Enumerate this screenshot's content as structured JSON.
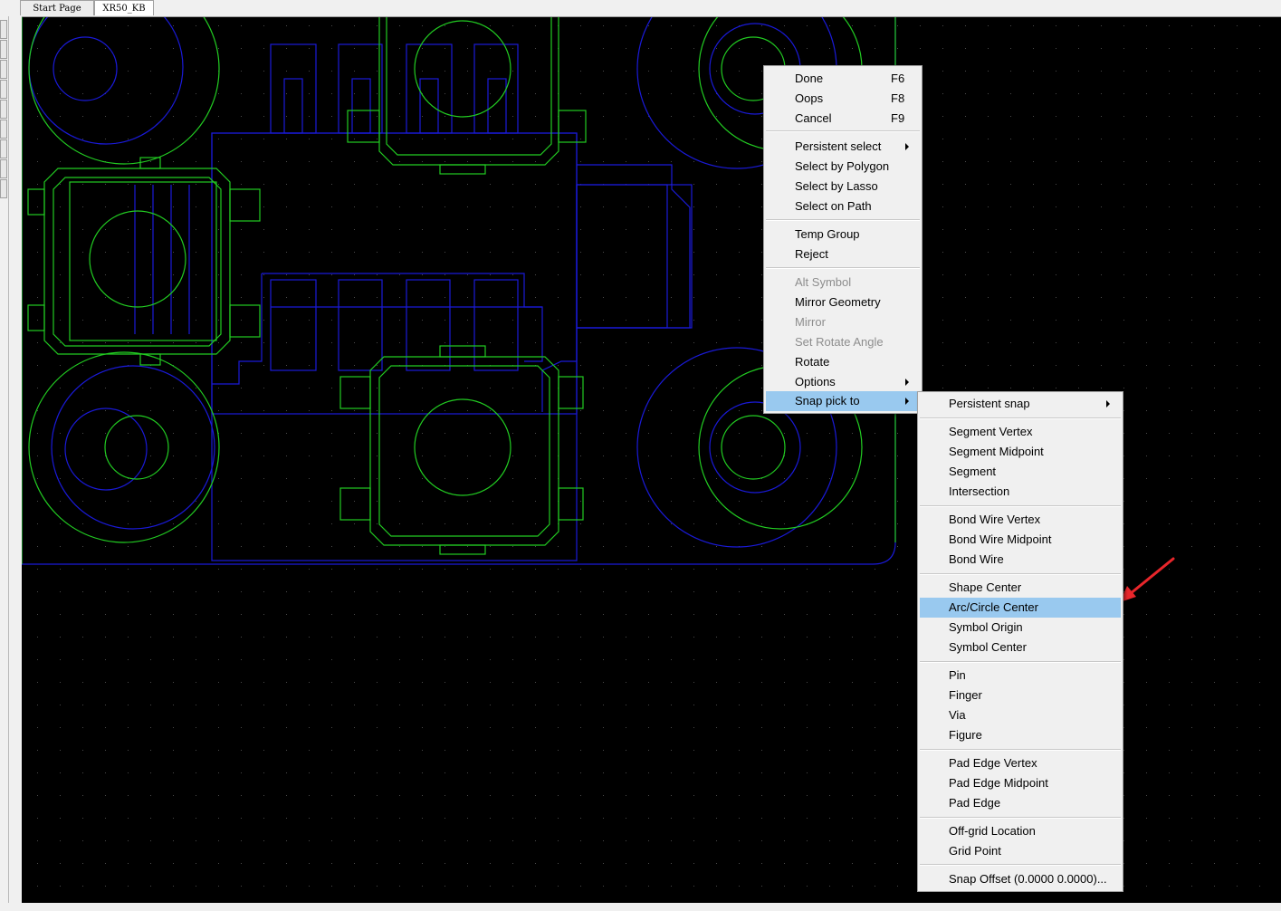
{
  "tabs": [
    {
      "label": "Start Page",
      "active": false
    },
    {
      "label": "XR50_KB",
      "active": true
    }
  ],
  "canvas": {
    "background": "#000000",
    "outline_color": "#1a1ad8",
    "pad_color": "#22cc22",
    "grid_dot_color": "#4a4a4a"
  },
  "context_menu": {
    "items": [
      {
        "label": "Done",
        "shortcut": "F6"
      },
      {
        "label": "Oops",
        "shortcut": "F8"
      },
      {
        "label": "Cancel",
        "shortcut": "F9"
      },
      {
        "label": "Persistent select",
        "submenu": true
      },
      {
        "label": "Select by Polygon"
      },
      {
        "label": "Select by Lasso"
      },
      {
        "label": "Select on Path"
      },
      {
        "label": "Temp Group"
      },
      {
        "label": "Reject"
      },
      {
        "label": "Alt Symbol",
        "disabled": true
      },
      {
        "label": "Mirror Geometry"
      },
      {
        "label": "Mirror",
        "disabled": true
      },
      {
        "label": "Set Rotate Angle",
        "disabled": true
      },
      {
        "label": "Rotate"
      },
      {
        "label": "Options",
        "submenu": true
      },
      {
        "label": "Snap pick to",
        "submenu": true,
        "highlighted": true
      }
    ]
  },
  "snap_submenu": {
    "items": [
      {
        "label": "Persistent snap",
        "submenu": true
      },
      {
        "label": "Segment Vertex"
      },
      {
        "label": "Segment Midpoint"
      },
      {
        "label": "Segment"
      },
      {
        "label": "Intersection"
      },
      {
        "label": "Bond Wire Vertex"
      },
      {
        "label": "Bond Wire Midpoint"
      },
      {
        "label": "Bond Wire"
      },
      {
        "label": "Shape Center"
      },
      {
        "label": "Arc/Circle Center",
        "highlighted": true
      },
      {
        "label": "Symbol Origin"
      },
      {
        "label": "Symbol Center"
      },
      {
        "label": "Pin"
      },
      {
        "label": "Finger"
      },
      {
        "label": "Via"
      },
      {
        "label": "Figure"
      },
      {
        "label": "Pad Edge Vertex"
      },
      {
        "label": "Pad Edge Midpoint"
      },
      {
        "label": "Pad Edge"
      },
      {
        "label": "Off-grid Location"
      },
      {
        "label": "Grid Point"
      },
      {
        "label": "Snap Offset (0.0000 0.0000)..."
      }
    ]
  },
  "annotation": {
    "arrow_color": "#e8262b",
    "points_to": "Arc/Circle Center"
  }
}
